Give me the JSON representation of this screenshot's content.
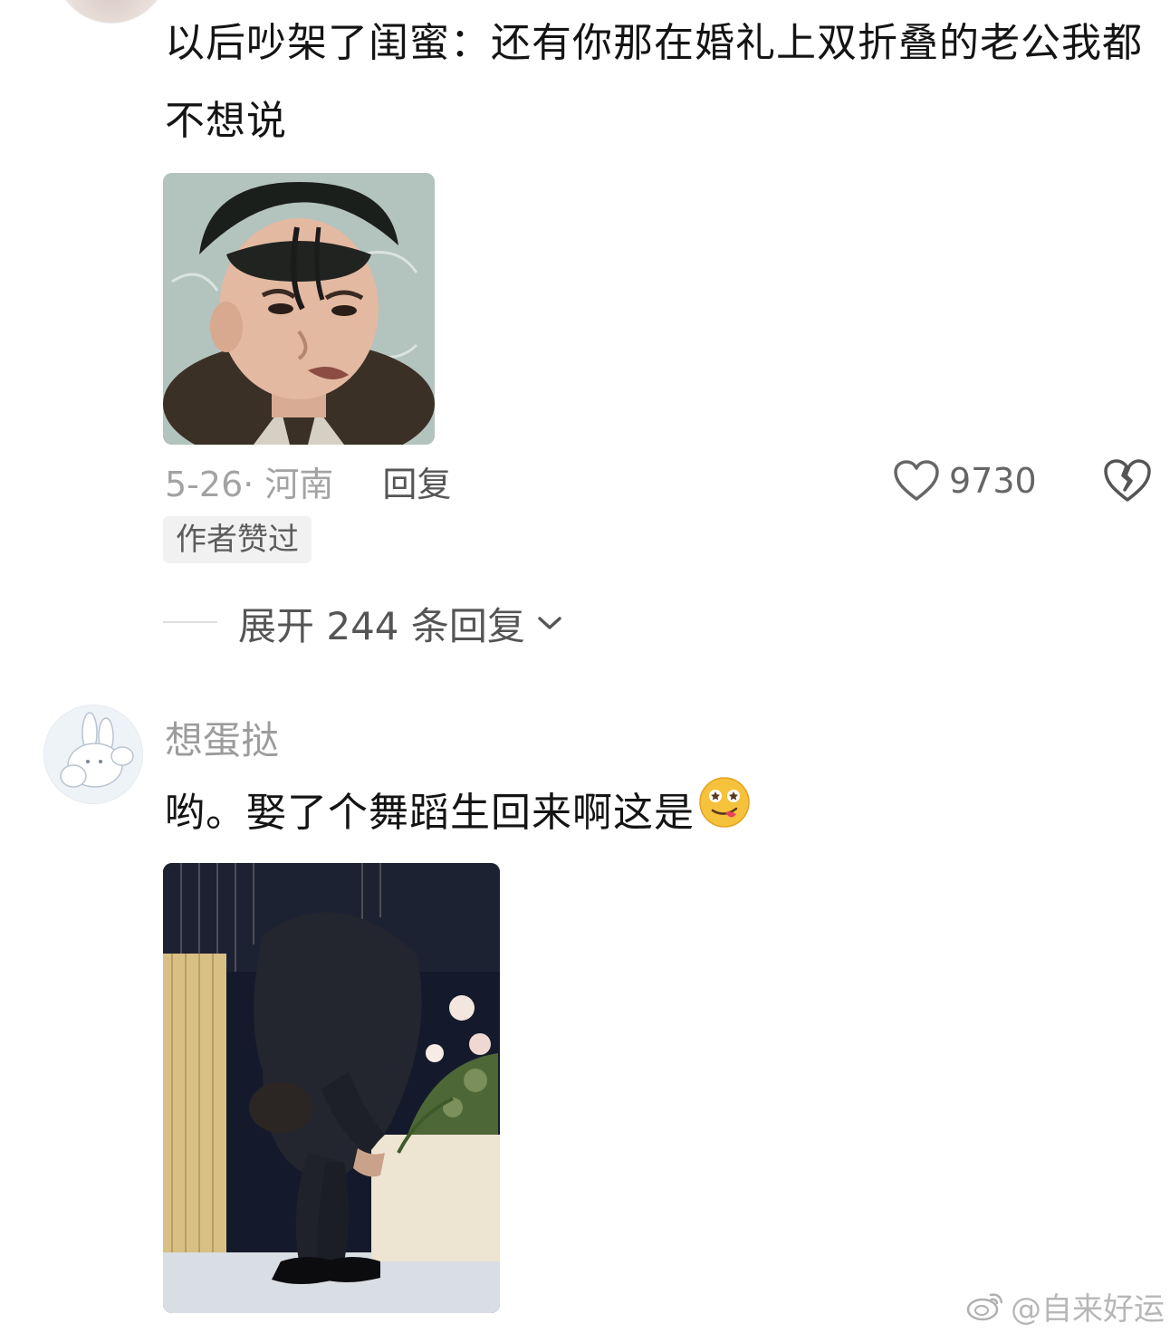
{
  "comment1": {
    "text": "以后吵架了闺蜜：还有你那在婚礼上双折叠的老公我都不想说",
    "date_location": "5-26· 河南",
    "reply_label": "回复",
    "like_count": "9730",
    "author_badge": "作者赞过",
    "expand_label": "展开 244 条回复"
  },
  "comment2": {
    "username": "想蛋挞",
    "text": "哟。娶了个舞蹈生回来啊这是"
  },
  "watermark": {
    "text": "@自来好运"
  },
  "icons": {
    "like": "heart-outline-icon",
    "dislike": "broken-heart-icon",
    "expand": "chevron-down-icon",
    "emoji": "drooling-face-emoji",
    "watermark": "weibo-logo-icon"
  }
}
